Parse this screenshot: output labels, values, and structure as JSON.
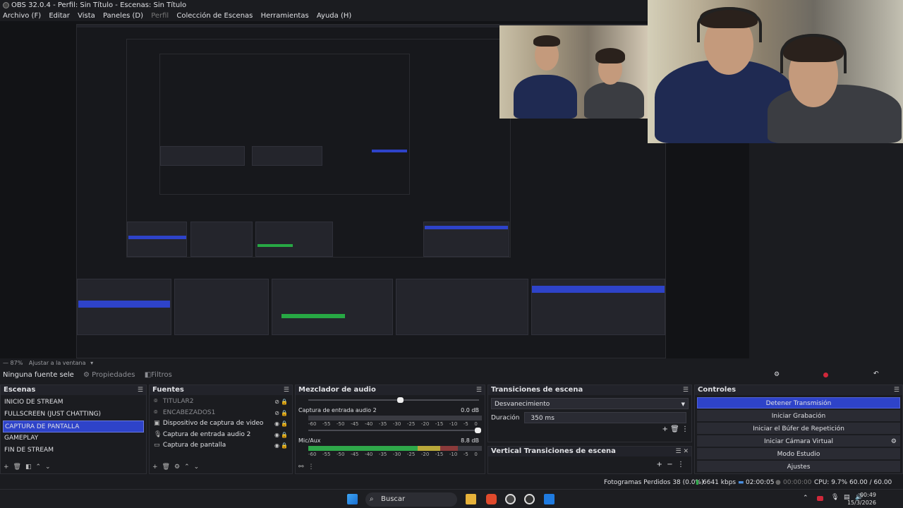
{
  "window": {
    "title": "OBS 32.0.4 - Perfil: Sin Título - Escenas: Sin Título"
  },
  "menu": [
    "Archivo (F)",
    "Editar",
    "Vista",
    "Paneles (D)",
    "Perfil",
    "Colección de Escenas",
    "Herramientas",
    "Ayuda (H)"
  ],
  "zoombar": {
    "zoom": "87%",
    "fit": "Ajustar a la ventana"
  },
  "sourcebar": {
    "no_source": "Ninguna fuente sele",
    "properties": "Propiedades",
    "filters": "Filtros"
  },
  "scenes": {
    "title": "Escenas",
    "items": [
      "INICIO DE STREAM",
      "FULLSCREEN (JUST CHATTING)",
      "CAPTURA DE PANTALLA",
      "GAMEPLAY",
      "FIN DE STREAM"
    ],
    "selected_index": 2
  },
  "sources": {
    "title": "Fuentes",
    "items": [
      {
        "label": "TITULAR2",
        "icon": "text-icon",
        "visible": false
      },
      {
        "label": "ENCABEZADOS1",
        "icon": "text-icon",
        "visible": false
      },
      {
        "label": "Dispositivo de captura de video",
        "icon": "camera-icon",
        "visible": true
      },
      {
        "label": "Captura de entrada audio 2",
        "icon": "mic-icon",
        "visible": true
      },
      {
        "label": "Captura de pantalla",
        "icon": "monitor-icon",
        "visible": true
      }
    ]
  },
  "mixer": {
    "title": "Mezclador de audio",
    "channels": [
      {
        "name": "Captura de entrada audio 2",
        "db": "0.0 dB",
        "level": 0.0
      },
      {
        "name": "Mic/Aux",
        "db": "8.8 dB",
        "level": 0.82
      }
    ],
    "ticks": [
      "-60",
      "-55",
      "-50",
      "-45",
      "-40",
      "-35",
      "-30",
      "-25",
      "-20",
      "-15",
      "-10",
      "-5",
      "0"
    ]
  },
  "transitions": {
    "title": "Transiciones de escena",
    "selected": "Desvanecimiento",
    "duration_label": "Duración",
    "duration_value": "350 ms",
    "vertical_title": "Vertical Transiciones de escena"
  },
  "controls": {
    "title": "Controles",
    "buttons": [
      "Detener Transmisión",
      "Iniciar Grabación",
      "Iniciar el Búfer de Repetición",
      "Iniciar Cámara Virtual",
      "Modo Estudio",
      "Ajustes"
    ]
  },
  "status": {
    "dropped": "Fotogramas Perdidos 38 (0.0%)",
    "bitrate": "6641 kbps",
    "stream_time": "02:00:05",
    "rec_time": "00:00:00",
    "cpu": "CPU: 9.7%",
    "fps": "60.00 / 60.00 FPS"
  },
  "taskbar": {
    "search": "Buscar",
    "time": "00:49",
    "date": "15/3/2026"
  },
  "colors": {
    "accent": "#2e43c9",
    "meter_green": "#2fa84a",
    "bg": "#1b1c20"
  }
}
